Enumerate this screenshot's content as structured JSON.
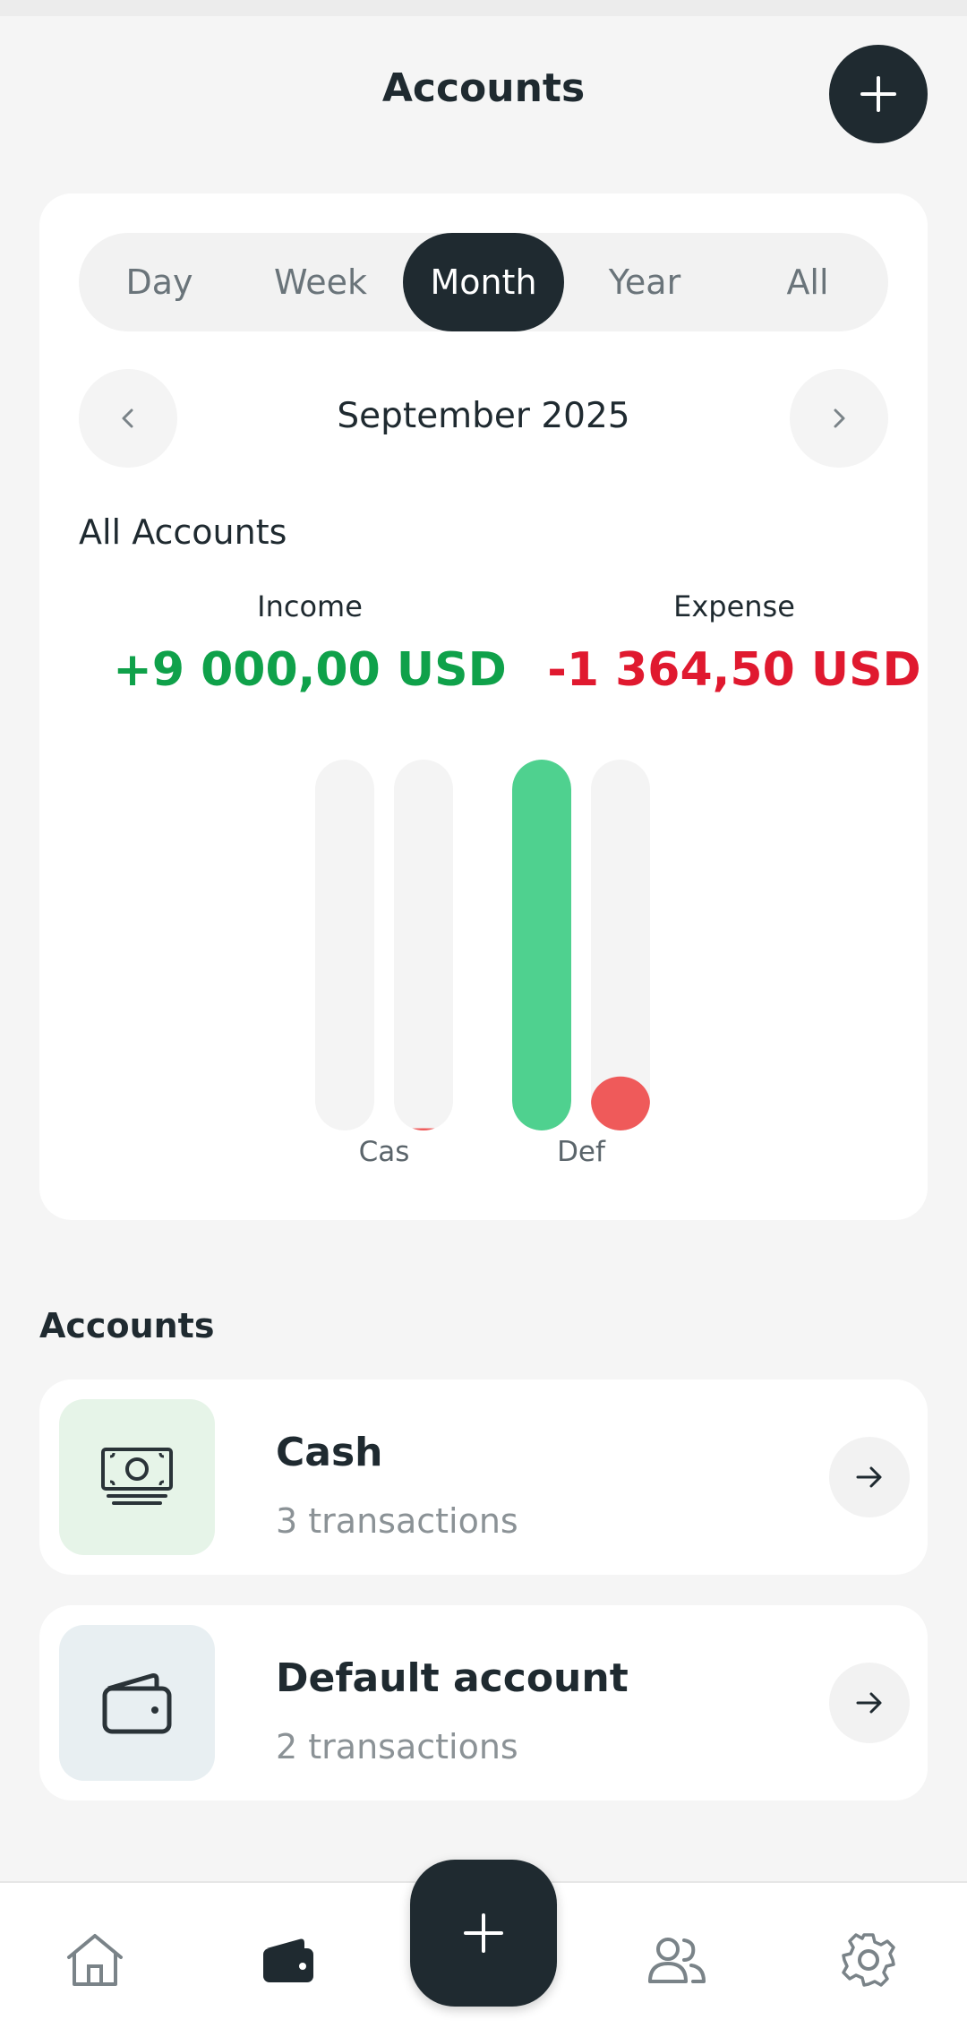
{
  "header": {
    "title": "Accounts"
  },
  "period_tabs": [
    {
      "label": "Day",
      "active": false
    },
    {
      "label": "Week",
      "active": false
    },
    {
      "label": "Month",
      "active": true
    },
    {
      "label": "Year",
      "active": false
    },
    {
      "label": "All",
      "active": false
    }
  ],
  "period": {
    "label": "September 2025"
  },
  "summary": {
    "section_label": "All Accounts",
    "income_caption": "Income",
    "income_value": "+9 000,00 USD",
    "expense_caption": "Expense",
    "expense_value": "-1 364,50 USD"
  },
  "chart_data": {
    "type": "bar",
    "categories": [
      "Cas",
      "Def"
    ],
    "series": [
      {
        "values": [
          0,
          9000
        ],
        "color": "#4fd18f"
      },
      {
        "values": [
          55,
          1309.5
        ],
        "color": "#ef5a5a"
      }
    ],
    "ylim": [
      0,
      9000
    ],
    "grid": false,
    "title": "",
    "xlabel": "",
    "ylabel": ""
  },
  "accounts_section": {
    "heading": "Accounts"
  },
  "accounts": [
    {
      "name": "Cash",
      "count": "3 transactions",
      "icon": "banknote-icon",
      "icon_bg": "#e6f4e8"
    },
    {
      "name": "Default account",
      "count": "2 transactions",
      "icon": "wallet-icon",
      "icon_bg": "#e8eff2"
    }
  ],
  "bottom_nav": [
    {
      "name": "home-icon"
    },
    {
      "name": "wallet-icon"
    },
    {
      "name": "add-icon"
    },
    {
      "name": "people-icon"
    },
    {
      "name": "gear-icon"
    }
  ],
  "colors": {
    "dark": "#1f2a30",
    "income": "#0fa14a",
    "expense": "#e0192f",
    "income_bar": "#4fd18f",
    "expense_bar": "#ef5a5a",
    "track": "#f4f4f4"
  }
}
